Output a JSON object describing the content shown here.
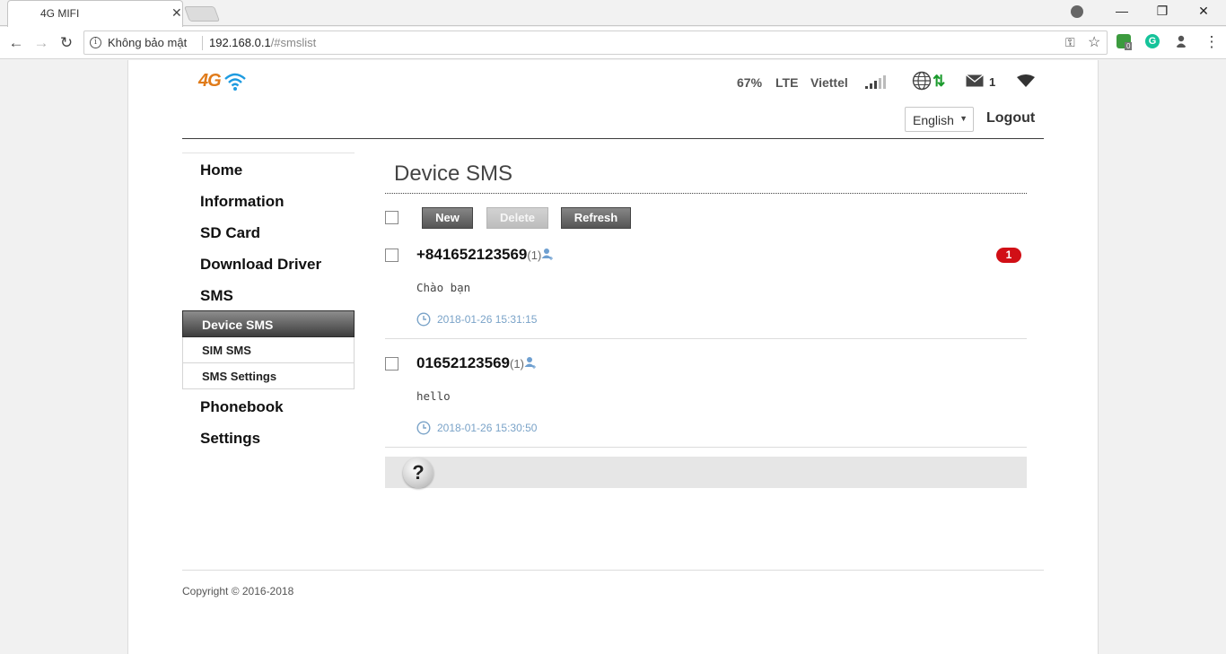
{
  "browser": {
    "tab_title": "4G MIFI",
    "tab_close": "✕",
    "window_controls": {
      "minimize": "—",
      "restore": "❐",
      "close": "✕"
    },
    "nav": {
      "back": "←",
      "forward": "→",
      "reload": "↻"
    },
    "omnibox": {
      "info_glyph": "i",
      "security_label": "Không bảo mật",
      "url_host": "192.168.0.1",
      "url_path": "/#smslist",
      "key_glyph": "⚿",
      "star_glyph": "☆"
    },
    "extension_badge": "0",
    "extension_letter": "G",
    "menu_glyph": "⋮"
  },
  "header": {
    "logo_text": "4G",
    "battery": "67%",
    "network_type": "LTE",
    "carrier": "Viettel",
    "data_arrows": "⇅",
    "signal_level": 3,
    "signal_max": 5,
    "sms_count": "1",
    "language": "English",
    "language_arrow": "▼",
    "logout_label": "Logout"
  },
  "sidebar": {
    "items": [
      "Home",
      "Information",
      "SD Card",
      "Download Driver",
      "SMS"
    ],
    "sms_sub_items": [
      "Device SMS",
      "SIM SMS",
      "SMS Settings"
    ],
    "bottom_items": [
      "Phonebook",
      "Settings"
    ]
  },
  "main": {
    "title": "Device SMS",
    "buttons": {
      "new": "New",
      "delete": "Delete",
      "refresh": "Refresh"
    },
    "messages": [
      {
        "number": "+841652123569",
        "count": "(1)",
        "content": "Chào bạn",
        "time": "2018-01-26 15:31:15",
        "unread": "1"
      },
      {
        "number": "01652123569",
        "count": "(1)",
        "content": "hello",
        "time": "2018-01-26 15:30:50"
      }
    ],
    "help_glyph": "?"
  },
  "footer": {
    "copyright": "Copyright © 2016-2018"
  },
  "colors": {
    "logo_orange": "#e07b1a",
    "wifi_blue": "#1e9be0",
    "badge_red": "#d10f16",
    "time_blue": "#7aa3c8",
    "data_green": "#1a9a2c"
  }
}
